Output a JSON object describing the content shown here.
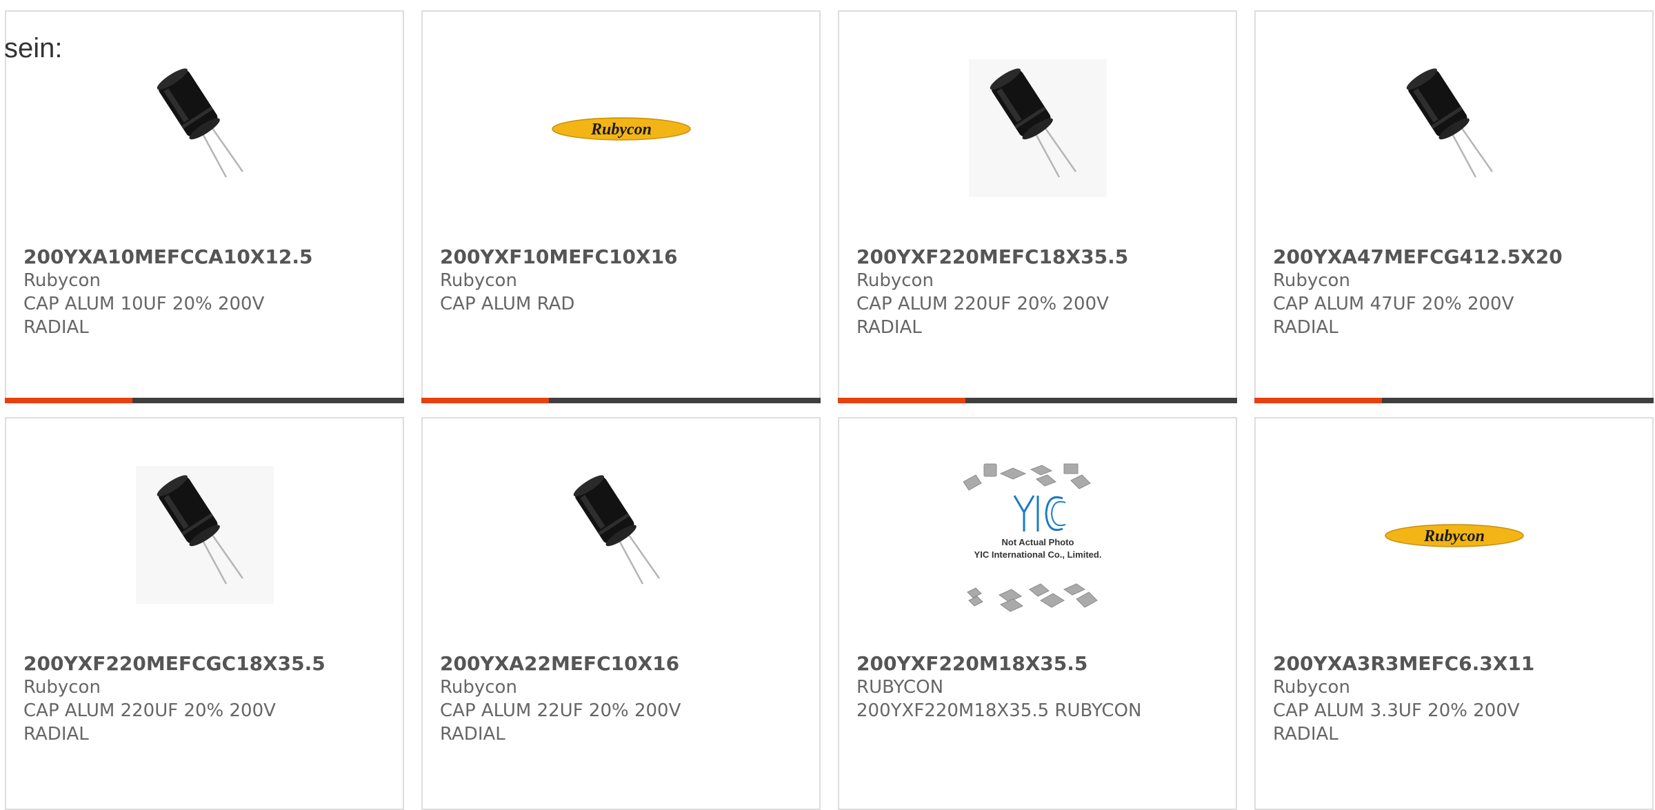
{
  "intro_text": "sein:",
  "colors": {
    "accent": "#e8400f",
    "bar_dark": "#3f3f3f",
    "logo_yellow": "#f2b515",
    "yic_blue": "#1a7bc4"
  },
  "products": [
    {
      "part_number": "200YXA10MEFCCA10X12.5",
      "manufacturer": "Rubycon",
      "desc_line1": "CAP ALUM 10UF 20% 200V",
      "desc_line2": "RADIAL",
      "image": "capacitor-icon",
      "has_bar": true
    },
    {
      "part_number": "200YXF10MEFC10X16",
      "manufacturer": "Rubycon",
      "desc_line1": "CAP ALUM RAD",
      "desc_line2": "",
      "image": "rubycon-logo",
      "logo_text": "Rubycon",
      "has_bar": true
    },
    {
      "part_number": "200YXF220MEFC18X35.5",
      "manufacturer": "Rubycon",
      "desc_line1": "CAP ALUM 220UF 20% 200V",
      "desc_line2": "RADIAL",
      "image": "capacitor-icon",
      "has_bar": true
    },
    {
      "part_number": "200YXA47MEFCG412.5X20",
      "manufacturer": "Rubycon",
      "desc_line1": "CAP ALUM 47UF 20% 200V",
      "desc_line2": "RADIAL",
      "image": "capacitor-icon",
      "has_bar": true
    },
    {
      "part_number": "200YXF220MEFCGC18X35.5",
      "manufacturer": "Rubycon",
      "desc_line1": "CAP ALUM 220UF 20% 200V",
      "desc_line2": "RADIAL",
      "image": "capacitor-icon",
      "has_bar": false
    },
    {
      "part_number": "200YXA22MEFC10X16",
      "manufacturer": "Rubycon",
      "desc_line1": "CAP ALUM 22UF 20% 200V",
      "desc_line2": "RADIAL",
      "image": "capacitor-icon",
      "has_bar": false
    },
    {
      "part_number": "200YXF220M18X35.5",
      "manufacturer": "RUBYCON",
      "desc_line1": "200YXF220M18X35.5 RUBYCON",
      "desc_line2": "",
      "image": "yic-placeholder",
      "placeholder_logo": "YIC",
      "placeholder_line1": "Not Actual Photo",
      "placeholder_line2": "YIC International Co., Limited.",
      "has_bar": false
    },
    {
      "part_number": "200YXA3R3MEFC6.3X11",
      "manufacturer": "Rubycon",
      "desc_line1": "CAP ALUM 3.3UF 20% 200V",
      "desc_line2": "RADIAL",
      "image": "rubycon-logo",
      "logo_text": "Rubycon",
      "has_bar": false
    }
  ]
}
